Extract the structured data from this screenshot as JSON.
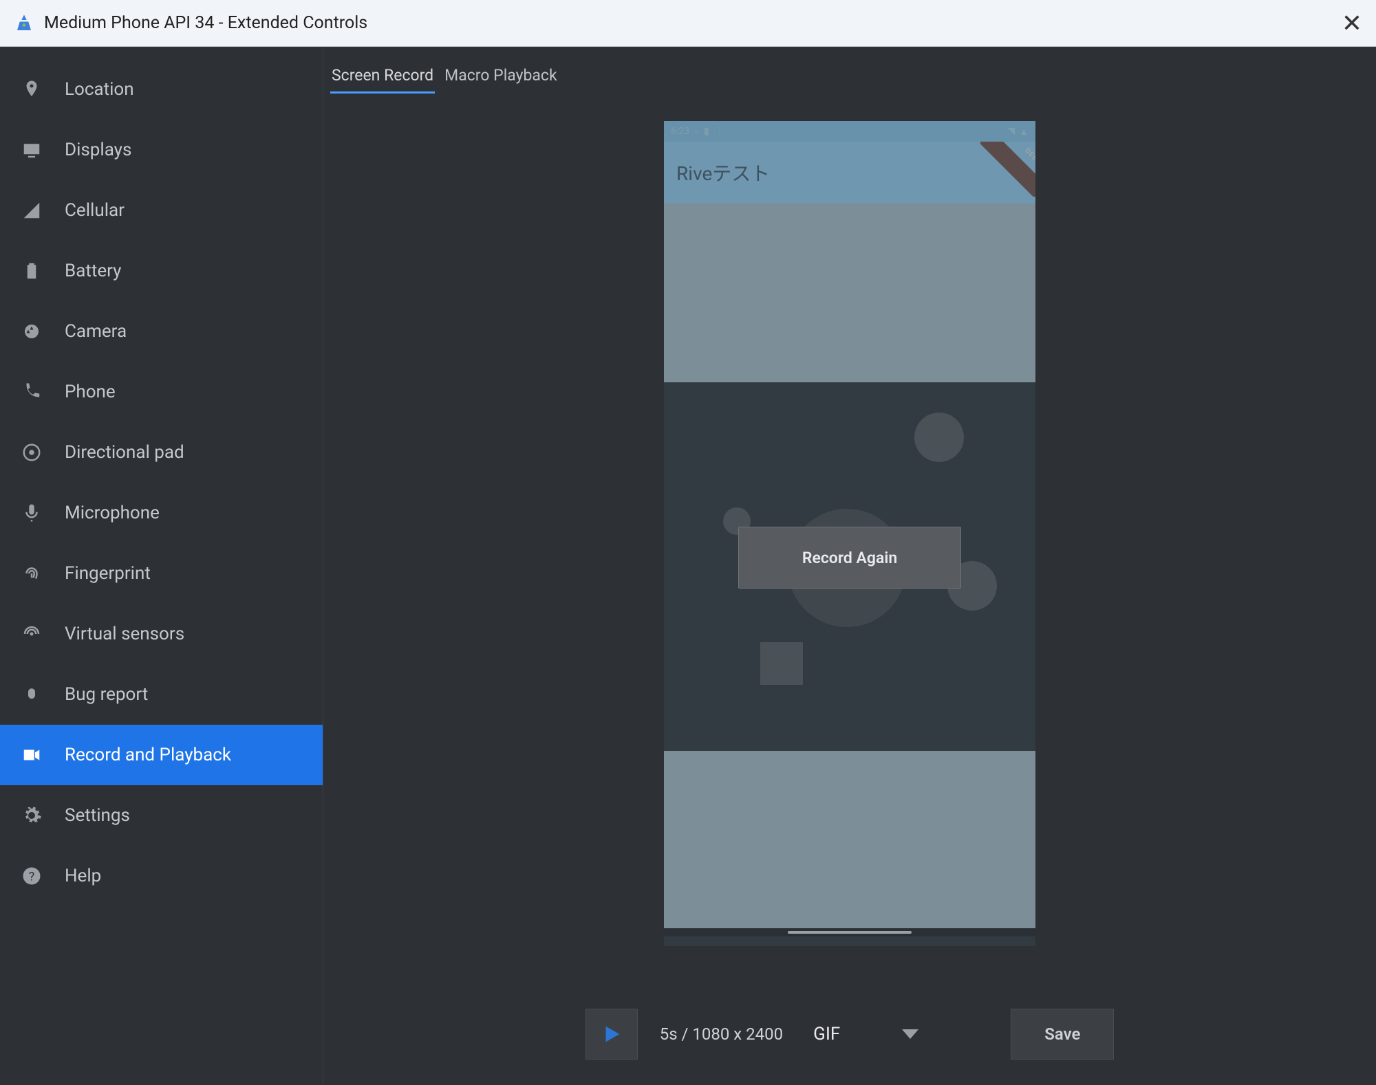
{
  "window": {
    "title": "Medium Phone API 34 - Extended Controls"
  },
  "sidebar": {
    "items": [
      {
        "label": "Location"
      },
      {
        "label": "Displays"
      },
      {
        "label": "Cellular"
      },
      {
        "label": "Battery"
      },
      {
        "label": "Camera"
      },
      {
        "label": "Phone"
      },
      {
        "label": "Directional pad"
      },
      {
        "label": "Microphone"
      },
      {
        "label": "Fingerprint"
      },
      {
        "label": "Virtual sensors"
      },
      {
        "label": "Bug report"
      },
      {
        "label": "Record and Playback"
      },
      {
        "label": "Settings"
      },
      {
        "label": "Help"
      }
    ],
    "selectedIndex": 11
  },
  "tabs": {
    "items": [
      {
        "label": "Screen Record"
      },
      {
        "label": "Macro Playback"
      }
    ],
    "activeIndex": 0
  },
  "preview": {
    "statusTime": "6:23",
    "appTitle": "Riveテスト",
    "debugBanner": "DEBUG",
    "overlayButton": "Record Again"
  },
  "footer": {
    "info": "5s / 1080 x 2400",
    "format": "GIF",
    "saveLabel": "Save"
  }
}
